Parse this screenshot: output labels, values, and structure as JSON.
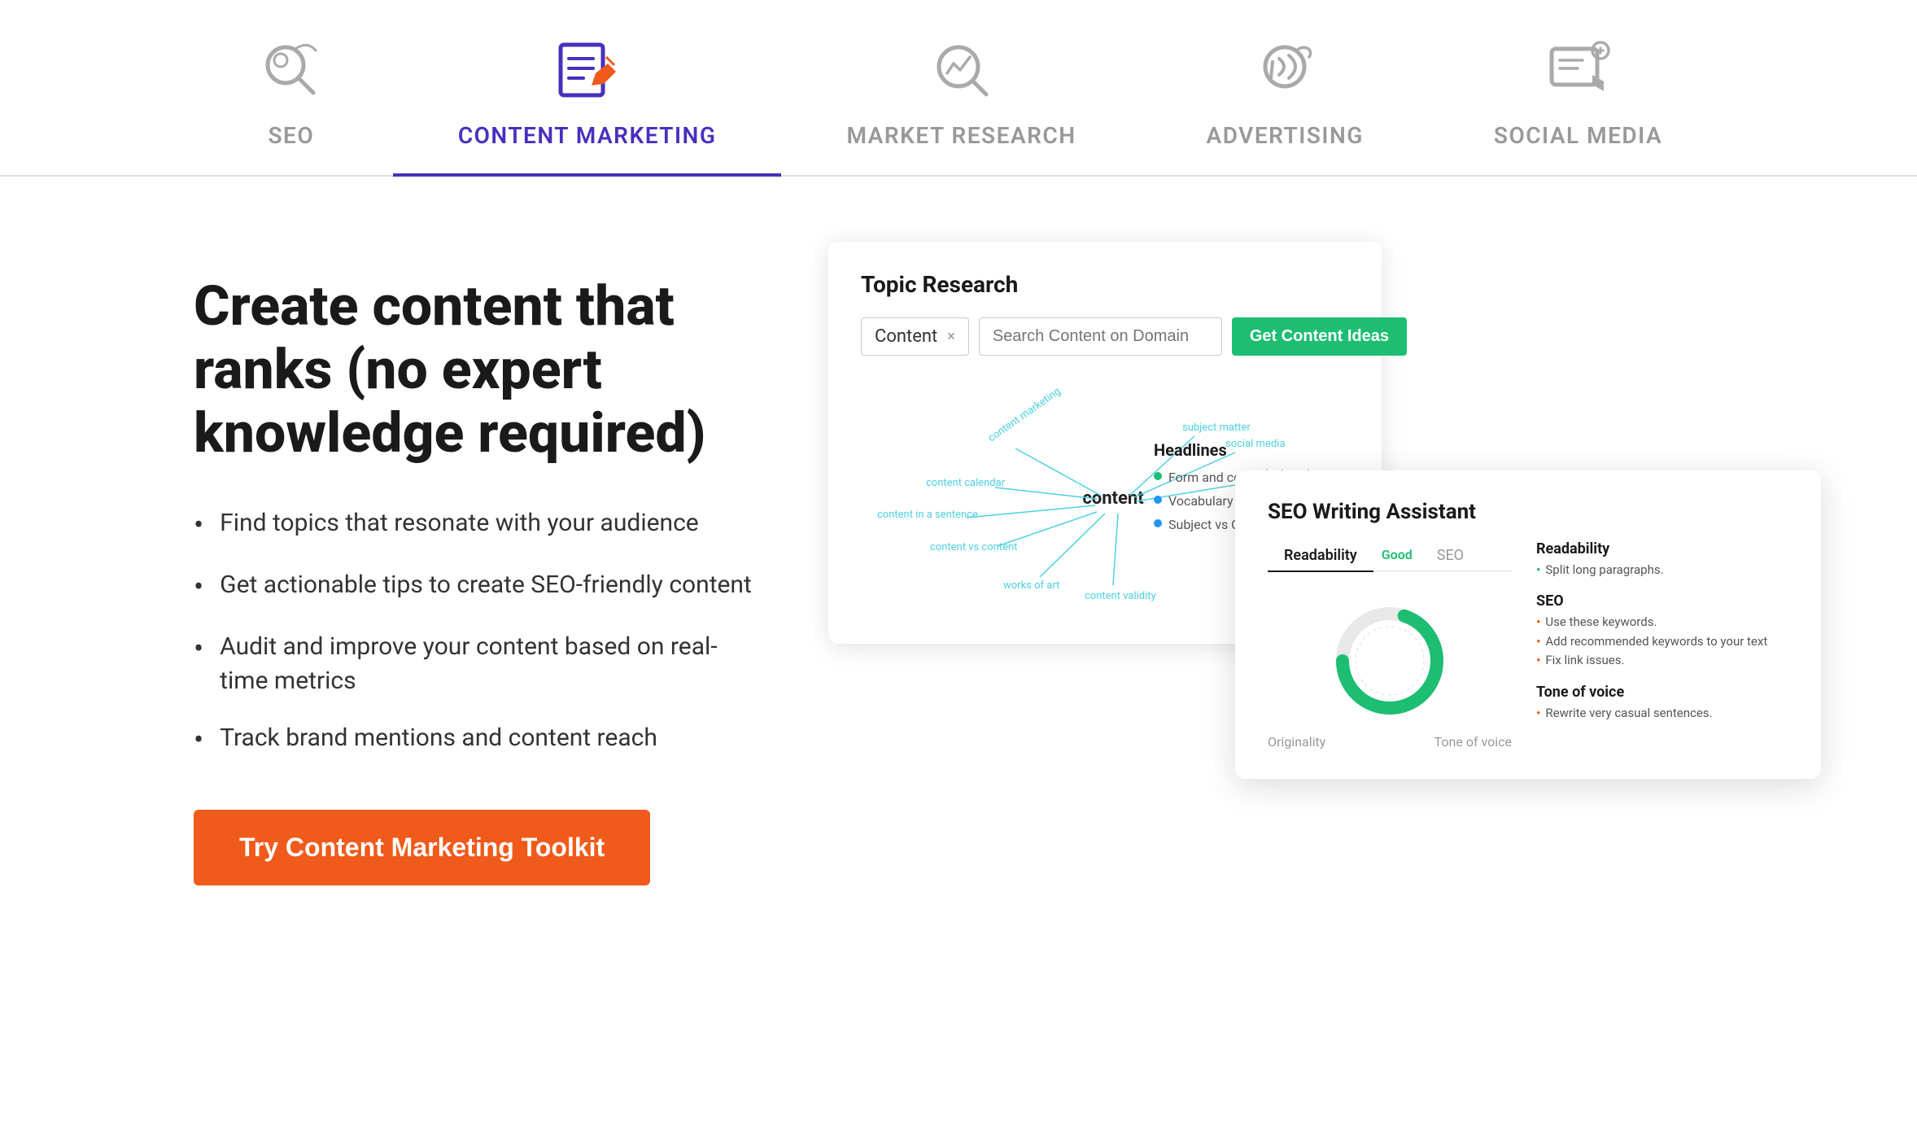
{
  "nav": {
    "tabs": [
      {
        "id": "seo",
        "label": "SEO",
        "active": false
      },
      {
        "id": "content-marketing",
        "label": "CONTENT MARKETING",
        "active": true
      },
      {
        "id": "market-research",
        "label": "MARKET RESEARCH",
        "active": false
      },
      {
        "id": "advertising",
        "label": "ADVERTISING",
        "active": false
      },
      {
        "id": "social-media",
        "label": "SOCIAL MEDIA",
        "active": false
      }
    ]
  },
  "hero": {
    "headline": "Create content that ranks (no expert knowledge required)",
    "features": [
      "Find topics that resonate with your audience",
      "Get actionable tips to create SEO-friendly content",
      "Audit and improve your content based on real-time metrics",
      "Track brand mentions and content reach"
    ],
    "cta_label": "Try Content Marketing Toolkit"
  },
  "topic_research": {
    "title": "Topic Research",
    "search_tag": "Content",
    "search_placeholder": "Search Content on Domain",
    "get_ideas_label": "Get Content Ideas",
    "headlines_title": "Headlines",
    "headlines": [
      {
        "text": "Form and content",
        "color": "green"
      },
      {
        "text": "Vocabulary of Art Terms",
        "color": "blue"
      },
      {
        "text": "Subject vs Content",
        "color": "blue"
      }
    ],
    "mind_map_nodes": [
      "content marketing",
      "content calendar",
      "content in a sentence",
      "content vs content",
      "works of art",
      "content validity",
      "subject matter",
      "social media",
      "content creator"
    ]
  },
  "seo_writing_assistant": {
    "title": "SEO Writing Assistant",
    "tabs": [
      "Readability",
      "Good",
      "SEO"
    ],
    "readability_label": "Readability",
    "good_label": "Good",
    "seo_label": "SEO",
    "originality_label": "Originality",
    "tone_of_voice_label": "Tone of voice",
    "sections": [
      {
        "title": "Readability",
        "items": [
          "Split long paragraphs."
        ],
        "color": "green"
      },
      {
        "title": "SEO",
        "items": [
          "Use these keywords.",
          "Add recommended keywords to your text",
          "Fix link issues."
        ],
        "color": "orange"
      },
      {
        "title": "Tone of voice",
        "items": [
          "Rewrite very casual sentences."
        ],
        "color": "orange"
      }
    ]
  }
}
